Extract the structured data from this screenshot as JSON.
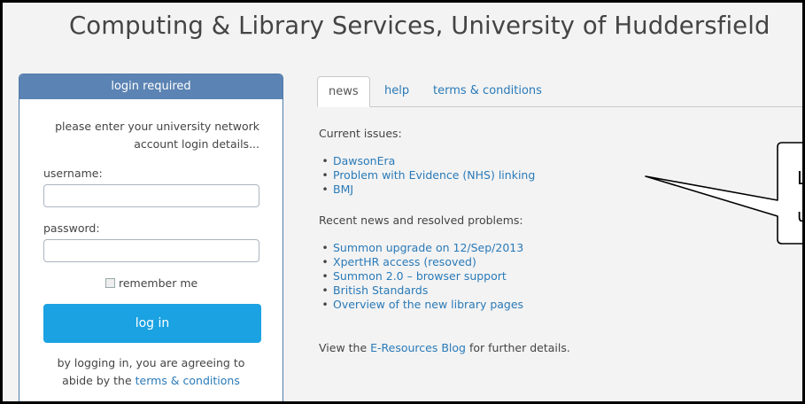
{
  "title": "Computing & Library Services, University of Huddersfield",
  "login": {
    "header": "login required",
    "intro_line1": "please enter your university network",
    "intro_line2": "account login details...",
    "username_label": "username:",
    "password_label": "password:",
    "remember_label": "remember me",
    "button_label": "log in",
    "agree_line1": "by logging in, you are agreeing to",
    "agree_line2_prefix": "abide by the ",
    "agree_link": "terms & conditions"
  },
  "tabs": [
    "news",
    "help",
    "terms & conditions"
  ],
  "news": {
    "current_heading": "Current issues:",
    "current_items": [
      "DawsonEra",
      "Problem with Evidence (NHS) linking",
      "BMJ"
    ],
    "recent_heading": "Recent news and resolved problems:",
    "recent_items": [
      "Summon upgrade on 12/Sep/2013",
      "XpertHR access (resoved)",
      "Summon 2.0 – browser support",
      "British Standards",
      "Overview of the new library pages"
    ],
    "footer_prefix": "View the ",
    "footer_link": "E-Resources Blog",
    "footer_suffix": " for further details."
  },
  "callout": {
    "line1": "L",
    "line2": "u"
  }
}
